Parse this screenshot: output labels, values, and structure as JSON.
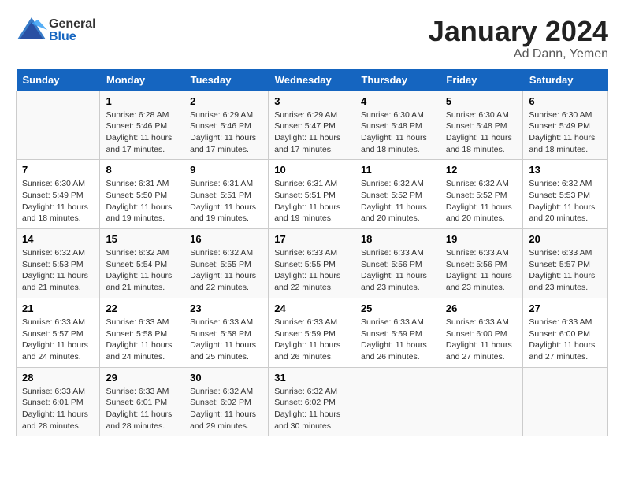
{
  "logo": {
    "general": "General",
    "blue": "Blue"
  },
  "title": {
    "month": "January 2024",
    "location": "Ad Dann, Yemen"
  },
  "calendar": {
    "headers": [
      "Sunday",
      "Monday",
      "Tuesday",
      "Wednesday",
      "Thursday",
      "Friday",
      "Saturday"
    ],
    "rows": [
      [
        {
          "day": "",
          "info": ""
        },
        {
          "day": "1",
          "info": "Sunrise: 6:28 AM\nSunset: 5:46 PM\nDaylight: 11 hours and 17 minutes."
        },
        {
          "day": "2",
          "info": "Sunrise: 6:29 AM\nSunset: 5:46 PM\nDaylight: 11 hours and 17 minutes."
        },
        {
          "day": "3",
          "info": "Sunrise: 6:29 AM\nSunset: 5:47 PM\nDaylight: 11 hours and 17 minutes."
        },
        {
          "day": "4",
          "info": "Sunrise: 6:30 AM\nSunset: 5:48 PM\nDaylight: 11 hours and 18 minutes."
        },
        {
          "day": "5",
          "info": "Sunrise: 6:30 AM\nSunset: 5:48 PM\nDaylight: 11 hours and 18 minutes."
        },
        {
          "day": "6",
          "info": "Sunrise: 6:30 AM\nSunset: 5:49 PM\nDaylight: 11 hours and 18 minutes."
        }
      ],
      [
        {
          "day": "7",
          "info": "Sunrise: 6:30 AM\nSunset: 5:49 PM\nDaylight: 11 hours and 18 minutes."
        },
        {
          "day": "8",
          "info": "Sunrise: 6:31 AM\nSunset: 5:50 PM\nDaylight: 11 hours and 19 minutes."
        },
        {
          "day": "9",
          "info": "Sunrise: 6:31 AM\nSunset: 5:51 PM\nDaylight: 11 hours and 19 minutes."
        },
        {
          "day": "10",
          "info": "Sunrise: 6:31 AM\nSunset: 5:51 PM\nDaylight: 11 hours and 19 minutes."
        },
        {
          "day": "11",
          "info": "Sunrise: 6:32 AM\nSunset: 5:52 PM\nDaylight: 11 hours and 20 minutes."
        },
        {
          "day": "12",
          "info": "Sunrise: 6:32 AM\nSunset: 5:52 PM\nDaylight: 11 hours and 20 minutes."
        },
        {
          "day": "13",
          "info": "Sunrise: 6:32 AM\nSunset: 5:53 PM\nDaylight: 11 hours and 20 minutes."
        }
      ],
      [
        {
          "day": "14",
          "info": "Sunrise: 6:32 AM\nSunset: 5:53 PM\nDaylight: 11 hours and 21 minutes."
        },
        {
          "day": "15",
          "info": "Sunrise: 6:32 AM\nSunset: 5:54 PM\nDaylight: 11 hours and 21 minutes."
        },
        {
          "day": "16",
          "info": "Sunrise: 6:32 AM\nSunset: 5:55 PM\nDaylight: 11 hours and 22 minutes."
        },
        {
          "day": "17",
          "info": "Sunrise: 6:33 AM\nSunset: 5:55 PM\nDaylight: 11 hours and 22 minutes."
        },
        {
          "day": "18",
          "info": "Sunrise: 6:33 AM\nSunset: 5:56 PM\nDaylight: 11 hours and 23 minutes."
        },
        {
          "day": "19",
          "info": "Sunrise: 6:33 AM\nSunset: 5:56 PM\nDaylight: 11 hours and 23 minutes."
        },
        {
          "day": "20",
          "info": "Sunrise: 6:33 AM\nSunset: 5:57 PM\nDaylight: 11 hours and 23 minutes."
        }
      ],
      [
        {
          "day": "21",
          "info": "Sunrise: 6:33 AM\nSunset: 5:57 PM\nDaylight: 11 hours and 24 minutes."
        },
        {
          "day": "22",
          "info": "Sunrise: 6:33 AM\nSunset: 5:58 PM\nDaylight: 11 hours and 24 minutes."
        },
        {
          "day": "23",
          "info": "Sunrise: 6:33 AM\nSunset: 5:58 PM\nDaylight: 11 hours and 25 minutes."
        },
        {
          "day": "24",
          "info": "Sunrise: 6:33 AM\nSunset: 5:59 PM\nDaylight: 11 hours and 26 minutes."
        },
        {
          "day": "25",
          "info": "Sunrise: 6:33 AM\nSunset: 5:59 PM\nDaylight: 11 hours and 26 minutes."
        },
        {
          "day": "26",
          "info": "Sunrise: 6:33 AM\nSunset: 6:00 PM\nDaylight: 11 hours and 27 minutes."
        },
        {
          "day": "27",
          "info": "Sunrise: 6:33 AM\nSunset: 6:00 PM\nDaylight: 11 hours and 27 minutes."
        }
      ],
      [
        {
          "day": "28",
          "info": "Sunrise: 6:33 AM\nSunset: 6:01 PM\nDaylight: 11 hours and 28 minutes."
        },
        {
          "day": "29",
          "info": "Sunrise: 6:33 AM\nSunset: 6:01 PM\nDaylight: 11 hours and 28 minutes."
        },
        {
          "day": "30",
          "info": "Sunrise: 6:32 AM\nSunset: 6:02 PM\nDaylight: 11 hours and 29 minutes."
        },
        {
          "day": "31",
          "info": "Sunrise: 6:32 AM\nSunset: 6:02 PM\nDaylight: 11 hours and 30 minutes."
        },
        {
          "day": "",
          "info": ""
        },
        {
          "day": "",
          "info": ""
        },
        {
          "day": "",
          "info": ""
        }
      ]
    ]
  }
}
